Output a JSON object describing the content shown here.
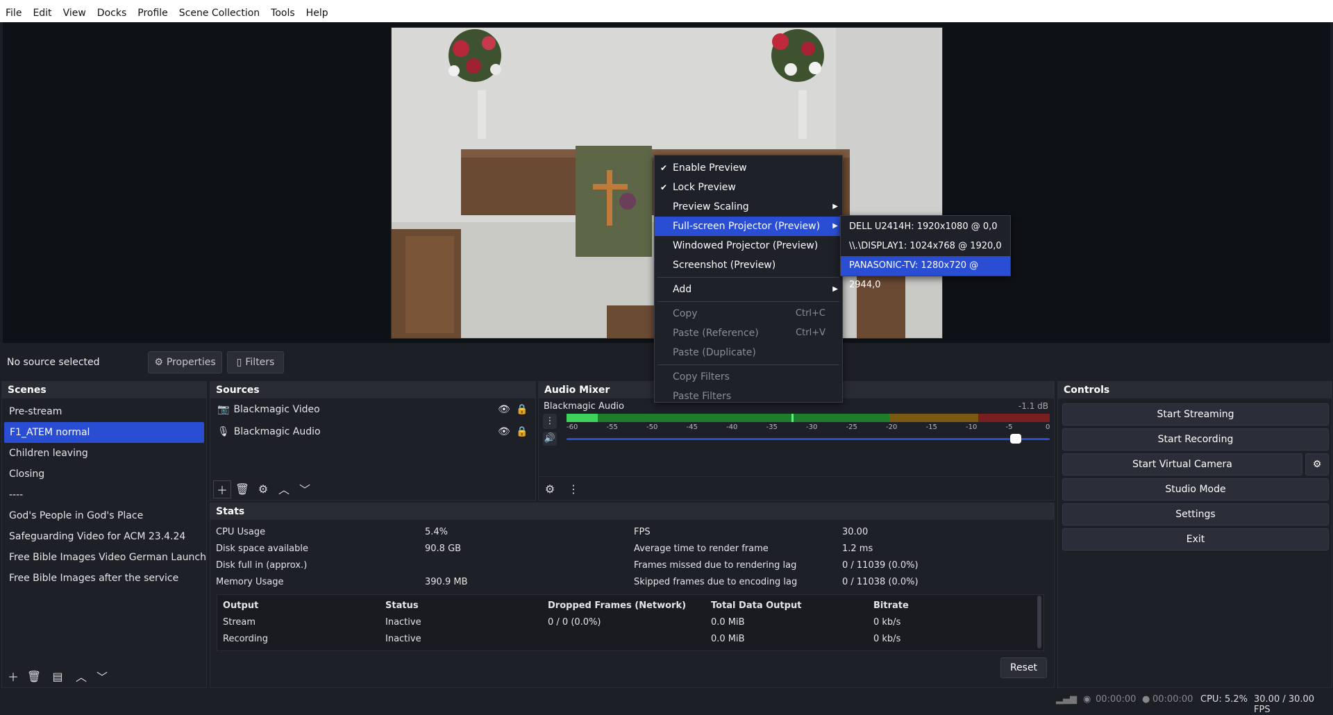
{
  "menubar": [
    "File",
    "Edit",
    "View",
    "Docks",
    "Profile",
    "Scene Collection",
    "Tools",
    "Help"
  ],
  "source_toolbar": {
    "no_source": "No source selected",
    "properties": "Properties",
    "filters": "Filters"
  },
  "scenes": {
    "title": "Scenes",
    "items": [
      "Pre-stream",
      "F1_ATEM normal",
      "Children leaving",
      "Closing",
      "----",
      "God's People in God's Place",
      "Safeguarding Video for ACM 23.4.24",
      "Free Bible Images Video German Launch",
      "Free Bible Images after the service"
    ],
    "selected_index": 1
  },
  "sources": {
    "title": "Sources",
    "items": [
      {
        "name": "Blackmagic Video",
        "icon": "camera-icon"
      },
      {
        "name": "Blackmagic Audio",
        "icon": "microphone-icon"
      }
    ]
  },
  "audio_mixer": {
    "title": "Audio Mixer",
    "channel": "Blackmagic Audio",
    "level": "-1.1 dB",
    "ticks": [
      "-60",
      "-55",
      "-50",
      "-45",
      "-40",
      "-35",
      "-30",
      "-25",
      "-20",
      "-15",
      "-10",
      "-5",
      "0"
    ],
    "volume_fraction": 0.93
  },
  "controls": {
    "title": "Controls",
    "buttons": [
      "Start Streaming",
      "Start Recording",
      "Start Virtual Camera",
      "Studio Mode",
      "Settings",
      "Exit"
    ]
  },
  "stats": {
    "title": "Stats",
    "left": [
      [
        "CPU Usage",
        "5.4%"
      ],
      [
        "Disk space available",
        "90.8 GB"
      ],
      [
        "Disk full in (approx.)",
        ""
      ],
      [
        "Memory Usage",
        "390.9 MB"
      ]
    ],
    "right": [
      [
        "FPS",
        "30.00"
      ],
      [
        "Average time to render frame",
        "1.2 ms"
      ],
      [
        "Frames missed due to rendering lag",
        "0 / 11039 (0.0%)"
      ],
      [
        "Skipped frames due to encoding lag",
        "0 / 11038 (0.0%)"
      ]
    ],
    "table_headers": [
      "Output",
      "Status",
      "Dropped Frames (Network)",
      "Total Data Output",
      "Bitrate"
    ],
    "rows": [
      [
        "Stream",
        "Inactive",
        "0 / 0 (0.0%)",
        "0.0 MiB",
        "0 kb/s"
      ],
      [
        "Recording",
        "Inactive",
        "",
        "0.0 MiB",
        "0 kb/s"
      ]
    ],
    "reset": "Reset"
  },
  "context_menu": {
    "items": [
      {
        "label": "Enable Preview",
        "checked": true
      },
      {
        "label": "Lock Preview",
        "checked": true
      },
      {
        "label": "Preview Scaling",
        "submenu": true
      },
      {
        "label": "Full-screen Projector (Preview)",
        "submenu": true,
        "highlight": true
      },
      {
        "label": "Windowed Projector (Preview)"
      },
      {
        "label": "Screenshot (Preview)"
      },
      {
        "label": "Add",
        "submenu": true
      },
      {
        "label": "Copy",
        "shortcut": "Ctrl+C",
        "disabled": true
      },
      {
        "label": "Paste (Reference)",
        "shortcut": "Ctrl+V",
        "disabled": true
      },
      {
        "label": "Paste (Duplicate)",
        "disabled": true
      },
      {
        "label": "Copy Filters",
        "disabled": true
      },
      {
        "label": "Paste Filters",
        "disabled": true
      }
    ]
  },
  "submenu": [
    "DELL U2414H: 1920x1080 @ 0,0",
    "\\\\.\\DISPLAY1: 1024x768 @ 1920,0",
    "PANASONIC-TV: 1280x720 @ 2944,0"
  ],
  "status_bar": {
    "stream_time": "00:00:00",
    "rec_time": "00:00:00",
    "cpu": "CPU: 5.2%",
    "fps": "30.00 / 30.00 FPS"
  }
}
